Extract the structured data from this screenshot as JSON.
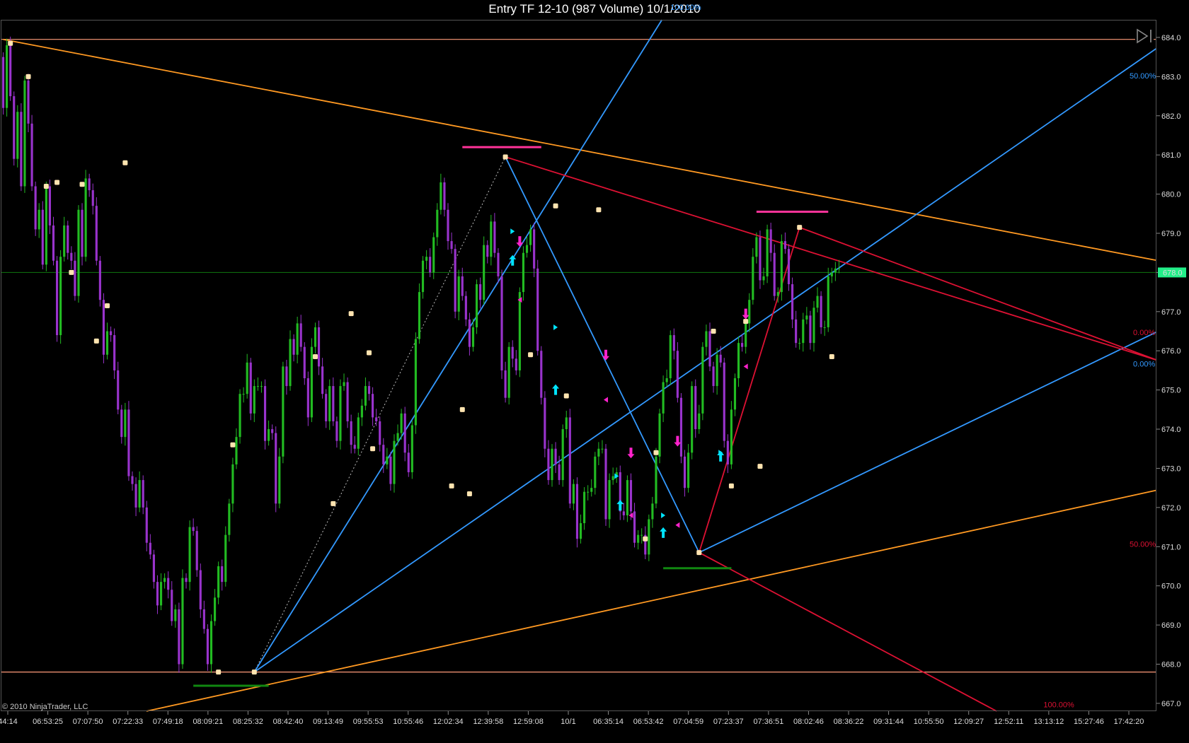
{
  "window": {
    "title": "Entry TF 12-10 (987 Volume)  10/1/2010",
    "copyright": "© 2010 NinjaTrader, LLC",
    "icon": "play-to-end-icon"
  },
  "chart_data": {
    "type": "candlestick",
    "title": "Entry TF 12-10 (987 Volume)  10/1/2010",
    "ylim": [
      666.8,
      684.45
    ],
    "y_ticks": [
      "684.0",
      "683.0",
      "682.0",
      "681.0",
      "680.0",
      "679.0",
      "678.0",
      "677.0",
      "676.0",
      "675.0",
      "674.0",
      "673.0",
      "672.0",
      "671.0",
      "670.0",
      "669.0",
      "668.0",
      "667.0"
    ],
    "x_ticks": [
      "44:14",
      "06:53:25",
      "07:07:50",
      "07:22:33",
      "07:49:18",
      "08:09:21",
      "08:25:32",
      "08:42:40",
      "09:13:49",
      "09:55:53",
      "10:55:46",
      "12:02:34",
      "12:39:58",
      "12:59:08",
      "10/1",
      "06:35:14",
      "06:53:42",
      "07:04:59",
      "07:23:37",
      "07:36:51",
      "08:02:46",
      "08:36:22",
      "09:31:44",
      "10:55:50",
      "12:09:27",
      "12:52:11",
      "13:13:12",
      "15:27:46",
      "17:42:20"
    ],
    "bar_count": 322,
    "last_price": "678.0",
    "price_line": 678.0,
    "colors": {
      "up": "#22bb22",
      "down": "#9933cc",
      "swing": "#ffe4b0",
      "orange": "#ff9922",
      "blue": "#3399ff",
      "red": "#dd1133",
      "pink": "#ff3399",
      "green": "#118811",
      "hline": "#ff9b7a",
      "arrow_up": "#00e5ff",
      "arrow_down": "#ff22cc",
      "price_line": "#117711"
    },
    "candles": [
      [
        683.5,
        682.2
      ],
      [
        682.2,
        683.8
      ],
      [
        683.8,
        682.5
      ],
      [
        682.5,
        680.9
      ],
      [
        680.9,
        682.1
      ],
      [
        682.1,
        680.2
      ],
      [
        680.2,
        682.9
      ],
      [
        682.9,
        681.8
      ],
      [
        681.8,
        680.2
      ],
      [
        680.2,
        679.1
      ],
      [
        679.1,
        679.6
      ],
      [
        679.6,
        678.2
      ],
      [
        678.2,
        680.2
      ],
      [
        680.2,
        679.2
      ],
      [
        679.2,
        678.3
      ],
      [
        678.3,
        676.4
      ],
      [
        676.4,
        678.4
      ],
      [
        678.4,
        679.2
      ],
      [
        679.2,
        678.5
      ],
      [
        678.5,
        678.3
      ],
      [
        678.3,
        677.4
      ],
      [
        677.4,
        679.6
      ],
      [
        679.6,
        678.4
      ],
      [
        678.4,
        680.4
      ],
      [
        680.4,
        680.1
      ],
      [
        680.1,
        679.7
      ],
      [
        679.7,
        678.3
      ],
      [
        678.3,
        677.3
      ],
      [
        677.3,
        675.9
      ],
      [
        675.9,
        676.5
      ],
      [
        676.5,
        676.4
      ],
      [
        676.4,
        675.5
      ],
      [
        675.5,
        674.5
      ],
      [
        674.5,
        673.8
      ],
      [
        673.8,
        674.5
      ],
      [
        674.5,
        672.8
      ],
      [
        672.8,
        672.6
      ],
      [
        672.6,
        672.0
      ],
      [
        672.0,
        672.7
      ],
      [
        672.7,
        672.0
      ],
      [
        672.0,
        671.1
      ],
      [
        671.1,
        670.8
      ],
      [
        670.8,
        670.1
      ],
      [
        670.1,
        669.5
      ],
      [
        669.5,
        670.1
      ],
      [
        670.1,
        670.2
      ],
      [
        670.2,
        669.9
      ],
      [
        669.9,
        669.1
      ],
      [
        669.1,
        669.4
      ],
      [
        669.4,
        668.0
      ],
      [
        668.0,
        670.2
      ],
      [
        670.2,
        670.1
      ],
      [
        670.1,
        671.5
      ],
      [
        671.5,
        671.4
      ],
      [
        671.4,
        670.4
      ],
      [
        670.4,
        669.4
      ],
      [
        669.4,
        668.9
      ],
      [
        668.9,
        668.0
      ],
      [
        668.0,
        669.1
      ],
      [
        669.1,
        669.7
      ],
      [
        669.7,
        670.5
      ],
      [
        670.5,
        670.1
      ],
      [
        670.1,
        671.3
      ],
      [
        671.3,
        672.1
      ],
      [
        672.1,
        673.1
      ],
      [
        673.1,
        673.8
      ],
      [
        673.8,
        674.9
      ],
      [
        674.9,
        674.9
      ],
      [
        674.9,
        675.7
      ],
      [
        675.7,
        674.4
      ],
      [
        674.4,
        675.1
      ],
      [
        675.1,
        675.1
      ],
      [
        675.1,
        675.1
      ],
      [
        675.1,
        673.7
      ],
      [
        673.7,
        674.0
      ],
      [
        674.0,
        673.9
      ],
      [
        673.9,
        672.1
      ],
      [
        672.1,
        673.3
      ],
      [
        673.3,
        675.6
      ],
      [
        675.6,
        675.1
      ],
      [
        675.1,
        676.3
      ],
      [
        676.3,
        675.9
      ],
      [
        675.9,
        676.7
      ],
      [
        676.7,
        676.1
      ],
      [
        676.1,
        675.3
      ],
      [
        675.3,
        674.3
      ],
      [
        674.3,
        676.1
      ],
      [
        676.1,
        676.6
      ],
      [
        676.6,
        675.6
      ],
      [
        675.6,
        674.9
      ],
      [
        674.9,
        674.2
      ],
      [
        674.2,
        675.1
      ],
      [
        675.1,
        674.2
      ],
      [
        674.2,
        673.7
      ],
      [
        673.7,
        675.1
      ],
      [
        675.1,
        675.2
      ],
      [
        675.2,
        674.2
      ],
      [
        674.2,
        673.6
      ],
      [
        673.6,
        673.5
      ],
      [
        673.5,
        674.3
      ],
      [
        674.3,
        674.6
      ],
      [
        674.6,
        675.1
      ],
      [
        675.1,
        674.9
      ],
      [
        674.9,
        674.3
      ],
      [
        674.3,
        674.2
      ],
      [
        674.2,
        673.6
      ],
      [
        673.6,
        673.1
      ],
      [
        673.1,
        673.3
      ],
      [
        673.3,
        672.6
      ],
      [
        672.6,
        673.7
      ],
      [
        673.7,
        673.9
      ],
      [
        673.9,
        674.4
      ],
      [
        674.4,
        673.4
      ],
      [
        673.4,
        672.9
      ],
      [
        672.9,
        674.1
      ],
      [
        674.1,
        676.3
      ],
      [
        676.3,
        677.5
      ],
      [
        677.5,
        678.3
      ],
      [
        678.3,
        678.4
      ],
      [
        678.4,
        678.0
      ],
      [
        678.0,
        678.9
      ],
      [
        678.9,
        679.6
      ],
      [
        679.6,
        680.3
      ],
      [
        680.3,
        679.6
      ],
      [
        679.6,
        678.8
      ],
      [
        678.8,
        678.6
      ],
      [
        678.6,
        677.0
      ],
      [
        677.0,
        677.9
      ],
      [
        677.9,
        677.4
      ],
      [
        677.4,
        676.8
      ],
      [
        676.8,
        676.1
      ],
      [
        676.1,
        676.6
      ],
      [
        676.6,
        677.7
      ],
      [
        677.7,
        677.3
      ],
      [
        677.3,
        678.7
      ],
      [
        678.7,
        678.4
      ],
      [
        678.4,
        679.3
      ],
      [
        679.3,
        678.5
      ],
      [
        678.5,
        677.9
      ],
      [
        677.9,
        675.5
      ],
      [
        675.5,
        674.8
      ],
      [
        674.8,
        676.1
      ],
      [
        676.1,
        675.8
      ],
      [
        675.8,
        675.5
      ],
      [
        675.5,
        677.5
      ],
      [
        677.5,
        678.5
      ],
      [
        678.5,
        678.7
      ],
      [
        678.7,
        679.1
      ],
      [
        679.1,
        678.1
      ],
      [
        678.1,
        676.0
      ],
      [
        676.0,
        674.8
      ],
      [
        674.8,
        673.5
      ],
      [
        673.5,
        672.7
      ],
      [
        672.7,
        673.5
      ],
      [
        673.5,
        673.1
      ],
      [
        673.1,
        672.7
      ],
      [
        672.7,
        674.0
      ],
      [
        674.0,
        674.3
      ],
      [
        674.3,
        672.1
      ],
      [
        672.1,
        672.6
      ],
      [
        672.6,
        671.2
      ],
      [
        671.2,
        671.6
      ],
      [
        671.6,
        672.4
      ],
      [
        672.4,
        672.4
      ],
      [
        672.4,
        672.5
      ],
      [
        672.5,
        673.3
      ],
      [
        673.3,
        673.5
      ],
      [
        673.5,
        673.5
      ],
      [
        673.5,
        671.7
      ],
      [
        671.7,
        672.7
      ],
      [
        672.7,
        672.8
      ],
      [
        672.8,
        672.9
      ],
      [
        672.9,
        671.9
      ],
      [
        671.9,
        671.8
      ],
      [
        671.8,
        672.7
      ],
      [
        672.7,
        671.9
      ],
      [
        671.9,
        671.1
      ],
      [
        671.1,
        671.3
      ],
      [
        671.3,
        671.3
      ],
      [
        671.3,
        670.8
      ],
      [
        670.8,
        671.7
      ],
      [
        671.7,
        672.1
      ],
      [
        672.1,
        673.3
      ],
      [
        673.3,
        674.4
      ],
      [
        674.4,
        675.2
      ],
      [
        675.2,
        675.3
      ],
      [
        675.3,
        676.4
      ],
      [
        676.4,
        676.0
      ],
      [
        676.0,
        674.8
      ],
      [
        674.8,
        673.3
      ],
      [
        673.3,
        672.5
      ],
      [
        672.5,
        673.4
      ],
      [
        673.4,
        675.1
      ],
      [
        675.1,
        674.0
      ],
      [
        674.0,
        674.4
      ],
      [
        674.4,
        676.1
      ],
      [
        676.1,
        676.5
      ],
      [
        676.5,
        675.6
      ],
      [
        675.6,
        675.1
      ],
      [
        675.1,
        675.9
      ],
      [
        675.9,
        675.7
      ],
      [
        675.7,
        673.7
      ],
      [
        673.7,
        673.1
      ],
      [
        673.1,
        674.5
      ],
      [
        674.5,
        675.3
      ],
      [
        675.3,
        676.2
      ],
      [
        676.2,
        676.1
      ],
      [
        676.1,
        676.7
      ],
      [
        676.7,
        677.3
      ],
      [
        677.3,
        678.4
      ],
      [
        678.4,
        678.9
      ],
      [
        678.9,
        677.8
      ],
      [
        677.8,
        677.9
      ],
      [
        677.9,
        679.1
      ],
      [
        679.1,
        678.5
      ],
      [
        678.5,
        677.4
      ],
      [
        677.4,
        677.5
      ],
      [
        677.5,
        678.8
      ],
      [
        678.8,
        678.6
      ],
      [
        678.6,
        677.7
      ],
      [
        677.7,
        676.8
      ],
      [
        676.8,
        676.2
      ],
      [
        676.2,
        676.2
      ],
      [
        676.2,
        676.8
      ],
      [
        676.8,
        676.9
      ],
      [
        676.9,
        676.2
      ],
      [
        676.2,
        677.1
      ],
      [
        677.1,
        677.4
      ],
      [
        677.4,
        676.6
      ],
      [
        676.6,
        676.6
      ],
      [
        676.6,
        677.9
      ],
      [
        677.9,
        678.0
      ],
      [
        678.0,
        678.1
      ],
      [
        678.1,
        678.1
      ]
    ],
    "swing_points": [
      [
        2,
        683.85
      ],
      [
        7,
        683.0
      ],
      [
        12,
        680.2
      ],
      [
        15,
        680.3
      ],
      [
        19,
        678.0
      ],
      [
        22,
        680.25
      ],
      [
        26,
        676.25
      ],
      [
        29,
        677.15
      ],
      [
        34,
        680.8
      ],
      [
        60,
        667.8
      ],
      [
        64,
        673.6
      ],
      [
        70,
        667.8
      ],
      [
        87,
        675.85
      ],
      [
        92,
        672.1
      ],
      [
        97,
        676.95
      ],
      [
        102,
        675.95
      ],
      [
        103,
        673.5
      ],
      [
        125,
        672.55
      ],
      [
        128,
        674.5
      ],
      [
        130,
        672.35
      ],
      [
        140,
        680.95
      ],
      [
        147,
        675.9
      ],
      [
        154,
        679.7
      ],
      [
        157,
        674.85
      ],
      [
        166,
        679.6
      ],
      [
        179,
        671.2
      ],
      [
        182,
        673.4
      ],
      [
        194,
        670.85
      ],
      [
        198,
        676.5
      ],
      [
        203,
        672.55
      ],
      [
        207,
        676.75
      ],
      [
        211,
        673.05
      ],
      [
        222,
        679.15
      ],
      [
        231,
        675.85
      ]
    ],
    "horizontal_lines": [
      683.95,
      667.8
    ],
    "trend_lines": [
      {
        "color": "orange",
        "from": [
          0,
          683.95
        ],
        "to": [
          322,
          678.3
        ]
      },
      {
        "color": "orange",
        "from": [
          0,
          666.0
        ],
        "to": [
          322,
          672.45
        ]
      },
      {
        "color": "blue",
        "from": [
          70,
          667.8
        ],
        "to": [
          185,
          684.65
        ]
      },
      {
        "color": "blue",
        "from": [
          70,
          667.8
        ],
        "to": [
          322,
          683.75
        ]
      },
      {
        "color": "blue",
        "from": [
          194,
          670.85
        ],
        "to": [
          322,
          676.5
        ]
      },
      {
        "color": "blue",
        "from": [
          140,
          680.95
        ],
        "to": [
          194,
          670.85
        ]
      },
      {
        "color": "red",
        "from": [
          140,
          680.95
        ],
        "to": [
          322,
          675.75
        ]
      },
      {
        "color": "red",
        "from": [
          194,
          670.85
        ],
        "to": [
          322,
          664.6
        ]
      },
      {
        "color": "red",
        "from": [
          222,
          679.15
        ],
        "to": [
          322,
          675.75
        ]
      },
      {
        "color": "red",
        "from": [
          194,
          670.85
        ],
        "to": [
          222,
          679.15
        ]
      }
    ],
    "dotted_lines": [
      {
        "from": [
          70,
          667.8
        ],
        "to": [
          140,
          680.95
        ]
      }
    ],
    "level_marks": [
      {
        "color": "pink",
        "from": [
          128,
          681.2
        ],
        "to": [
          150,
          681.2
        ]
      },
      {
        "color": "pink",
        "from": [
          210,
          679.55
        ],
        "to": [
          230,
          679.55
        ]
      },
      {
        "color": "green",
        "from": [
          53,
          667.45
        ],
        "to": [
          74,
          667.45
        ]
      },
      {
        "color": "green",
        "from": [
          184,
          670.45
        ],
        "to": [
          203,
          670.45
        ]
      }
    ],
    "arrows_up": [
      [
        142,
        678.3
      ],
      [
        154,
        675.0
      ],
      [
        172,
        672.05
      ],
      [
        184,
        671.35
      ],
      [
        200,
        673.3
      ]
    ],
    "arrows_down": [
      [
        144,
        678.8
      ],
      [
        168,
        675.9
      ],
      [
        175,
        673.4
      ],
      [
        188,
        673.7
      ],
      [
        207,
        676.95
      ]
    ],
    "triangles_right": [
      [
        142,
        679.05
      ],
      [
        154,
        676.6
      ],
      [
        171,
        672.8
      ],
      [
        184,
        671.8
      ],
      [
        200,
        673.4
      ]
    ],
    "triangles_left": [
      [
        144,
        677.3
      ],
      [
        168,
        674.75
      ],
      [
        175,
        671.8
      ],
      [
        188,
        671.55
      ],
      [
        207,
        675.6
      ]
    ],
    "fib_labels": [
      {
        "text": "100.00%",
        "color": "blue",
        "at": [
          186,
          684.7
        ]
      },
      {
        "text": "50.00%",
        "color": "blue",
        "at": [
          314,
          682.95
        ]
      },
      {
        "text": "0.00%",
        "color": "red",
        "at": [
          315,
          676.4
        ]
      },
      {
        "text": "0.00%",
        "color": "blue",
        "at": [
          315,
          675.6
        ]
      },
      {
        "text": "50.00%",
        "color": "red",
        "at": [
          314,
          671.0
        ]
      },
      {
        "text": "100.00%",
        "color": "red",
        "at": [
          290,
          666.9
        ]
      }
    ]
  }
}
